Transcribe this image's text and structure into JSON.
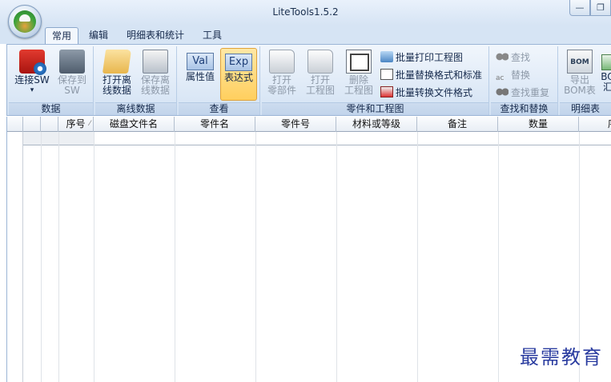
{
  "window": {
    "title": "LiteTools1.5.2",
    "minimize_glyph": "—",
    "restore_glyph": "❐"
  },
  "tabs": [
    {
      "label": "常用",
      "active": true
    },
    {
      "label": "编辑",
      "active": false
    },
    {
      "label": "明细表和统计",
      "active": false
    },
    {
      "label": "工具",
      "active": false
    }
  ],
  "ribbon": {
    "data_group": {
      "label": "数据",
      "connect_label_1": "连接SW",
      "connect_label_2": "▾",
      "save_label_1": "保存到",
      "save_label_2": "SW"
    },
    "offline_group": {
      "label": "离线数据",
      "open_label_1": "打开离",
      "open_label_2": "线数据",
      "save_label_1": "保存离",
      "save_label_2": "线数据"
    },
    "view_group": {
      "label": "查看",
      "val_icon_text": "Val",
      "val_label": "属性值",
      "exp_icon_text": "Exp",
      "exp_label": "表达式"
    },
    "parts_group": {
      "label": "零件和工程图",
      "open_part_1": "打开",
      "open_part_2": "零部件",
      "open_drawing_1": "打开",
      "open_drawing_2": "工程图",
      "delete_drawing_1": "删除",
      "delete_drawing_2": "工程图",
      "batch_print": "批量打印工程图",
      "batch_replace_format": "批量替换格式和标准",
      "batch_convert": "批量转换文件格式"
    },
    "find_group": {
      "label": "查找和替换",
      "find": "查找",
      "replace": "替换",
      "find_dup": "查找重复"
    },
    "bom_group": {
      "label": "明细表",
      "export_bom_1": "导出",
      "export_bom_2": "BOM表",
      "bom_icon_text": "BOM",
      "bom2_label_1": "BO",
      "bom2_label_2": "汇"
    }
  },
  "table": {
    "columns": [
      "序号",
      "磁盘文件名",
      "零件名",
      "零件号",
      "材料或等级",
      "备注",
      "数量",
      "",
      ""
    ],
    "sort_indicator": "⁄",
    "last_col_partial": "序"
  },
  "watermark": "最需教育"
}
